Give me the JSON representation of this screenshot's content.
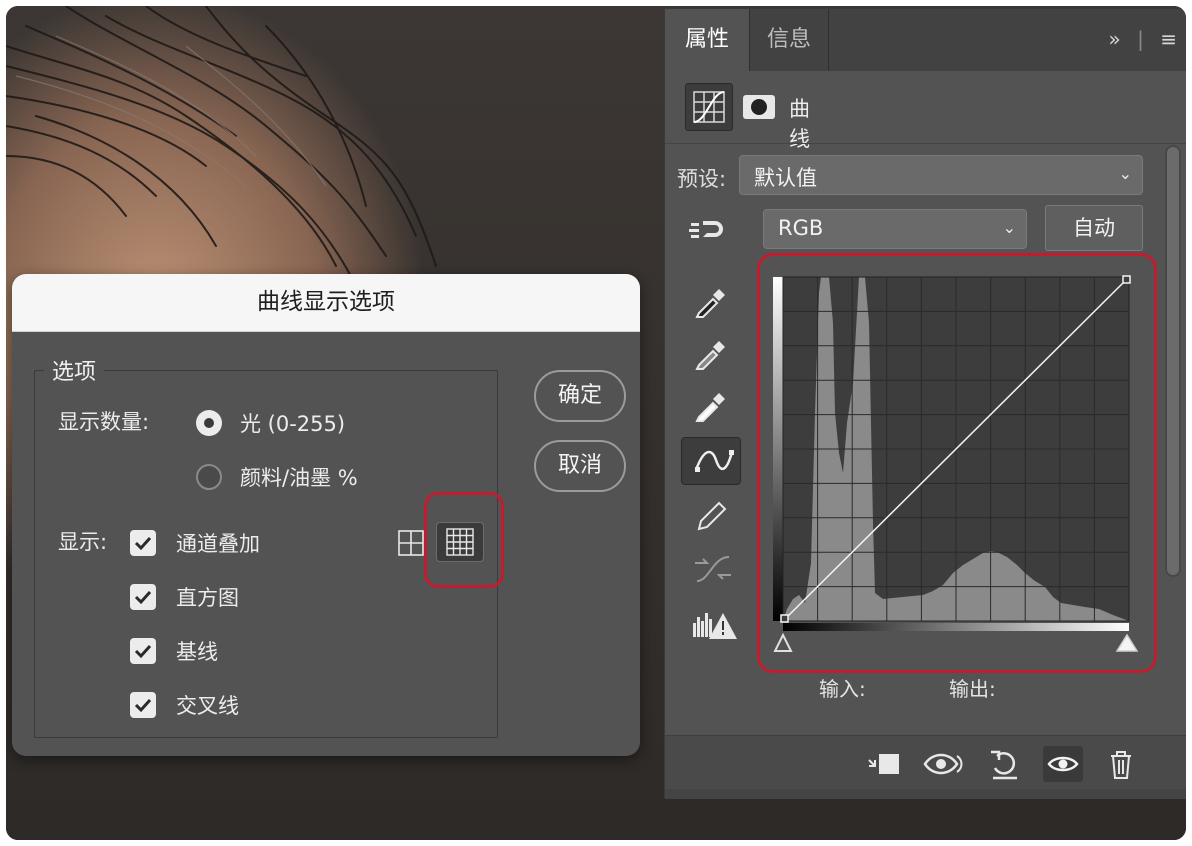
{
  "panel": {
    "tabs": [
      {
        "label": "属性"
      },
      {
        "label": "信息"
      }
    ],
    "tab_tools": {
      "collapse": "»",
      "menu": "≡"
    },
    "adjustment_name": "曲线",
    "preset_label": "预设:",
    "preset_value": "默认值",
    "channel_value": "RGB",
    "auto_label": "自动",
    "input_label": "输入:",
    "output_label": "输出:"
  },
  "dialog": {
    "title": "曲线显示选项",
    "group_title": "选项",
    "show_amount_label": "显示数量:",
    "radio_light_label": "光 (0-255)",
    "radio_ink_label": "颜料/油墨 %",
    "radio_selected": "light",
    "show_label": "显示:",
    "checkboxes": [
      {
        "label": "通道叠加",
        "checked": true
      },
      {
        "label": "直方图",
        "checked": true
      },
      {
        "label": "基线",
        "checked": true
      },
      {
        "label": "交叉线",
        "checked": true
      }
    ],
    "grid_mode_selected": "fine",
    "ok_label": "确定",
    "cancel_label": "取消"
  },
  "colors": {
    "panel_bg": "#535353",
    "highlight_red": "#c01e2e",
    "dialog_titlebar": "#f6f6f6"
  },
  "icons": {
    "panel_tools": [
      "hand-targeted-adjust-icon",
      "black-eyedropper-icon",
      "gray-eyedropper-icon",
      "white-eyedropper-icon",
      "curve-point-icon",
      "pencil-icon",
      "smooth-curve-icon",
      "clipping-warning-icon"
    ],
    "footer": [
      "clip-to-layer-icon",
      "view-previous-icon",
      "reset-icon",
      "visibility-icon",
      "delete-icon"
    ]
  }
}
